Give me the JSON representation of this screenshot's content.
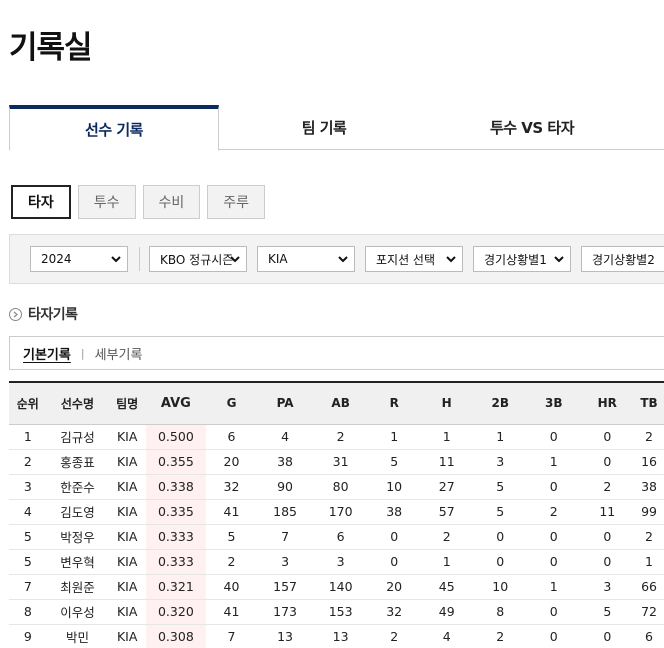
{
  "page": {
    "title": "기록실"
  },
  "main_tabs": [
    {
      "label": "선수 기록",
      "active": true
    },
    {
      "label": "팀 기록",
      "active": false
    },
    {
      "label": "투수 VS 타자",
      "active": false
    }
  ],
  "sub_tabs": [
    {
      "label": "타자",
      "active": true
    },
    {
      "label": "투수",
      "active": false
    },
    {
      "label": "수비",
      "active": false
    },
    {
      "label": "주루",
      "active": false
    }
  ],
  "filters": {
    "season": "2024",
    "series": "KBO 정규시즌",
    "team": "KIA",
    "position": "포지션 선택",
    "situation1": "경기상황별1",
    "situation2": "경기상황별2"
  },
  "section": {
    "title": "타자기록"
  },
  "record_tabs": [
    {
      "label": "기본기록",
      "active": true
    },
    {
      "label": "세부기록",
      "active": false
    }
  ],
  "table": {
    "headers": [
      "순위",
      "선수명",
      "팀명",
      "AVG",
      "G",
      "PA",
      "AB",
      "R",
      "H",
      "2B",
      "3B",
      "HR",
      "TB"
    ],
    "rows": [
      [
        "1",
        "김규성",
        "KIA",
        "0.500",
        "6",
        "4",
        "2",
        "1",
        "1",
        "1",
        "0",
        "0",
        "2"
      ],
      [
        "2",
        "홍종표",
        "KIA",
        "0.355",
        "20",
        "38",
        "31",
        "5",
        "11",
        "3",
        "1",
        "0",
        "16"
      ],
      [
        "3",
        "한준수",
        "KIA",
        "0.338",
        "32",
        "90",
        "80",
        "10",
        "27",
        "5",
        "0",
        "2",
        "38"
      ],
      [
        "4",
        "김도영",
        "KIA",
        "0.335",
        "41",
        "185",
        "170",
        "38",
        "57",
        "5",
        "2",
        "11",
        "99"
      ],
      [
        "5",
        "박정우",
        "KIA",
        "0.333",
        "5",
        "7",
        "6",
        "0",
        "2",
        "0",
        "0",
        "0",
        "2"
      ],
      [
        "5",
        "변우혁",
        "KIA",
        "0.333",
        "2",
        "3",
        "3",
        "0",
        "1",
        "0",
        "0",
        "0",
        "1"
      ],
      [
        "7",
        "최원준",
        "KIA",
        "0.321",
        "40",
        "157",
        "140",
        "20",
        "45",
        "10",
        "1",
        "3",
        "66"
      ],
      [
        "8",
        "이우성",
        "KIA",
        "0.320",
        "41",
        "173",
        "153",
        "32",
        "49",
        "8",
        "0",
        "5",
        "72"
      ],
      [
        "9",
        "박민",
        "KIA",
        "0.308",
        "7",
        "13",
        "13",
        "2",
        "4",
        "2",
        "0",
        "0",
        "6"
      ]
    ]
  },
  "colors": {
    "accent": "#0d2a5c",
    "avg_highlight": "#fff0f1"
  }
}
